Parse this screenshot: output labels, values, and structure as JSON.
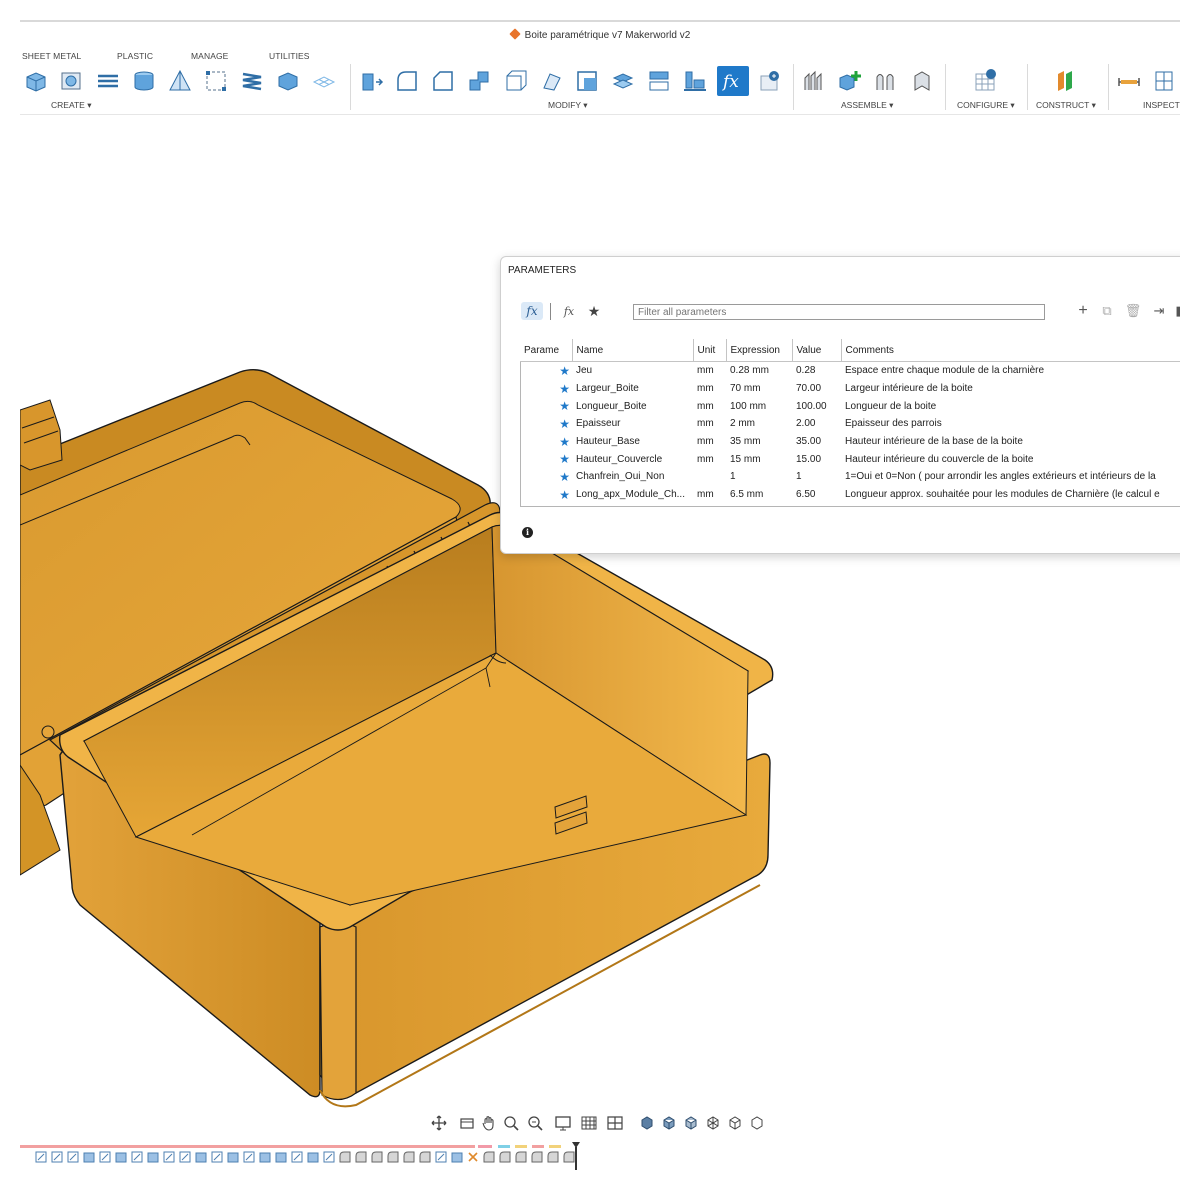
{
  "window": {
    "title": "Boite paramétrique v7 Makerworld v2"
  },
  "ribbon": {
    "tabs": [
      "SHEET METAL",
      "PLASTIC",
      "MANAGE",
      "UTILITIES"
    ],
    "groups": [
      "CREATE ▾",
      "MODIFY ▾",
      "ASSEMBLE ▾",
      "CONFIGURE ▾",
      "CONSTRUCT ▾",
      "INSPECT"
    ]
  },
  "parameters": {
    "title": "PARAMETERS",
    "filter_placeholder": "Filter all parameters",
    "toolbar": {
      "fx": "fx",
      "fx2": "fx",
      "star": "★",
      "add": "+",
      "copy": "⧉",
      "delete": "🗑",
      "import": "⇥",
      "export": "▮"
    },
    "columns": [
      "Parame",
      "Name",
      "Unit",
      "Expression",
      "Value",
      "Comments"
    ],
    "rows": [
      {
        "name": "Jeu",
        "unit": "mm",
        "expression": "0.28 mm",
        "value": "0.28",
        "comment": "Espace entre chaque module de la charnière"
      },
      {
        "name": "Largeur_Boite",
        "unit": "mm",
        "expression": "70 mm",
        "value": "70.00",
        "comment": "Largeur intérieure de la boite"
      },
      {
        "name": "Longueur_Boite",
        "unit": "mm",
        "expression": "100 mm",
        "value": "100.00",
        "comment": "Longueur de la boite"
      },
      {
        "name": "Epaisseur",
        "unit": "mm",
        "expression": "2 mm",
        "value": "2.00",
        "comment": "Epaisseur des parrois"
      },
      {
        "name": "Hauteur_Base",
        "unit": "mm",
        "expression": "35 mm",
        "value": "35.00",
        "comment": "Hauteur intérieure de la base de la boite"
      },
      {
        "name": "Hauteur_Couvercle",
        "unit": "mm",
        "expression": "15 mm",
        "value": "15.00",
        "comment": "Hauteur intérieure du couvercle  de la boite"
      },
      {
        "name": "Chanfrein_Oui_Non",
        "unit": "",
        "expression": "1",
        "value": "1",
        "comment": "1=Oui  et  0=Non ( pour arrondir les angles extérieurs et intérieurs de la"
      },
      {
        "name": "Long_apx_Module_Ch...",
        "unit": "mm",
        "expression": "6.5 mm",
        "value": "6.50",
        "comment": "Longueur approx. souhaitée pour les modules de Charnière (le calcul e"
      }
    ],
    "info_icon": "i"
  },
  "colors": {
    "accent": "#1f79c9",
    "model_body": "#e3a33a",
    "model_shadow": "#c98a22",
    "model_highlight": "#f0b64a",
    "edge": "#1a1a1a"
  },
  "icons": {
    "navbar": [
      "orbit-icon",
      "look-at-icon",
      "pan-icon",
      "zoom-window-icon",
      "zoom-icon",
      "display-settings-icon",
      "grid-icon",
      "viewports-icon",
      "cube-shaded-icon",
      "cube-shaded-edges-icon",
      "cube-hidden-icon",
      "cube-wireframe-icon",
      "cube-outline-icon",
      "cube-visible-edges-icon"
    ],
    "timeline": "timeline-feature-icon"
  }
}
